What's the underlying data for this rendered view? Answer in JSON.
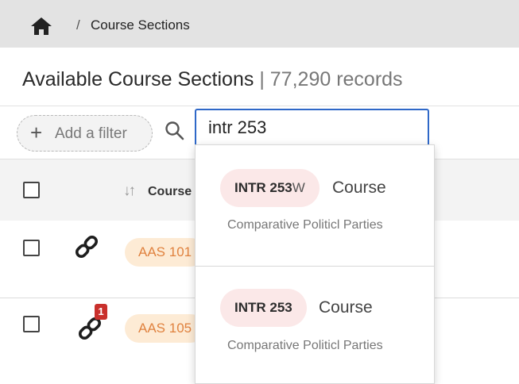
{
  "breadcrumb": {
    "separator": "/",
    "current": "Course Sections",
    "home_icon": "home-icon"
  },
  "page": {
    "title": "Available Course Sections",
    "divider": "|",
    "record_count": "77,290 records"
  },
  "toolbar": {
    "add_filter_icon": "+",
    "add_filter_label": "Add a filter",
    "search_icon": "search-icon"
  },
  "search": {
    "value": "intr 253"
  },
  "table": {
    "header": {
      "sort_icon": "↓↑",
      "course_column": "Course"
    },
    "rows": [
      {
        "link_icon": "link-icon",
        "course": "AAS 101"
      },
      {
        "link_icon": "link-icon",
        "badge": "1",
        "course": "AAS 105"
      }
    ]
  },
  "dropdown": {
    "options": [
      {
        "code": "INTR 253",
        "suffix": "W",
        "type": "Course",
        "description": "Comparative Politicl Parties"
      },
      {
        "code": "INTR 253",
        "suffix": "",
        "type": "Course",
        "description": "Comparative Politicl Parties"
      }
    ]
  },
  "colors": {
    "accent_blue": "#2f68c8",
    "course_badge_bg": "#fdebd5",
    "course_badge_text": "#e0823f",
    "dropdown_pill_bg": "#fbe8e8",
    "notification_red": "#c9302c"
  }
}
